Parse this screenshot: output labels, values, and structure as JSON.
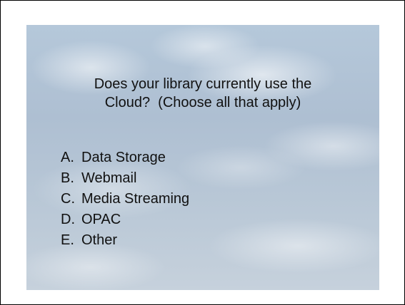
{
  "question": {
    "line1": "Does your library currently use the",
    "line2": "Cloud?  (Choose all that apply)"
  },
  "options": [
    {
      "letter": "A.",
      "text": "Data Storage"
    },
    {
      "letter": "B.",
      "text": "Webmail"
    },
    {
      "letter": "C.",
      "text": "Media Streaming"
    },
    {
      "letter": "D.",
      "text": "OPAC"
    },
    {
      "letter": "E.",
      "text": "Other"
    }
  ],
  "colors": {
    "text": "#111111",
    "sky": "#b5c8da",
    "frame": "#000000"
  }
}
